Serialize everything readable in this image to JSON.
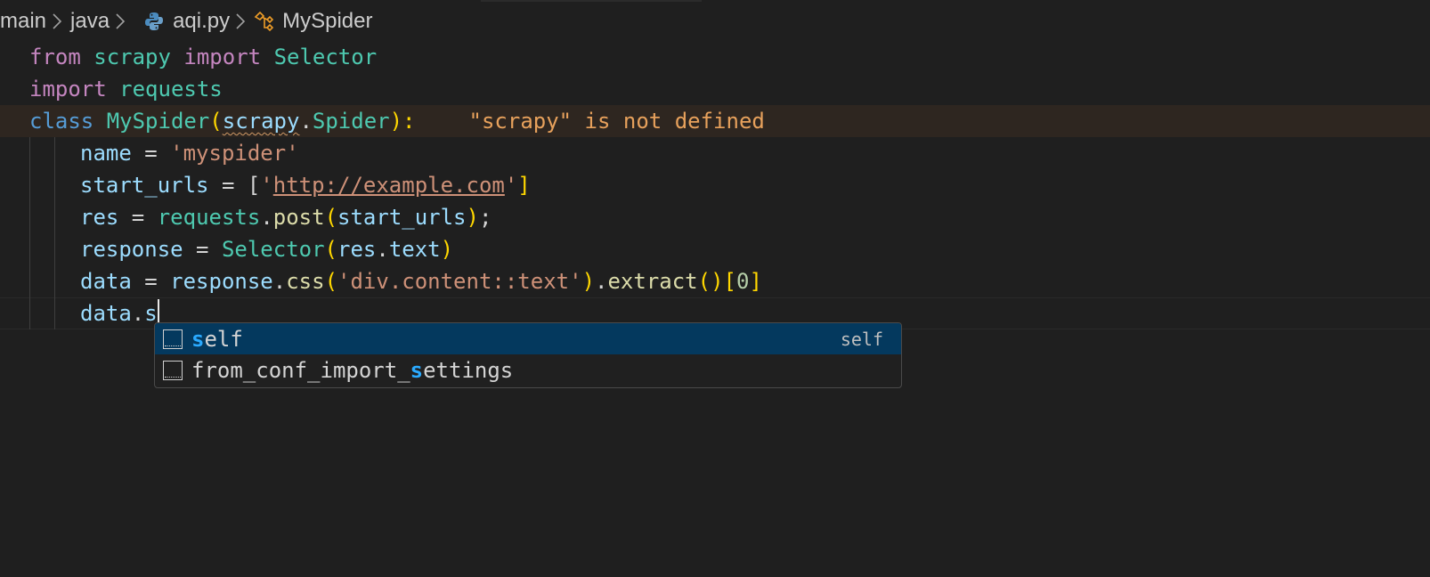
{
  "breadcrumb": {
    "items": [
      {
        "label": "main",
        "icon": null
      },
      {
        "label": "java",
        "icon": null
      },
      {
        "label": "aqi.py",
        "icon": "python-file-icon"
      },
      {
        "label": "MySpider",
        "icon": "symbol-class-icon"
      }
    ]
  },
  "editor": {
    "line1": {
      "t1": "from",
      "t2": " ",
      "t3": "scrapy",
      "t4": " ",
      "t5": "import",
      "t6": " ",
      "t7": "Selector"
    },
    "line2": {
      "t1": "import",
      "t2": " ",
      "t3": "requests"
    },
    "line3": {
      "t1": "class",
      "t2": " ",
      "t3": "MySpider",
      "t4": "(",
      "t5": "scrapy",
      "t6": ".",
      "t7": "Spider",
      "t8": "):",
      "diagnostic": "\"scrapy\" is not defined"
    },
    "line4": {
      "t1": "name",
      "t2": " = ",
      "t3": "'myspider'"
    },
    "line5": {
      "t1": "start_urls",
      "t2": " = [",
      "t3": "'",
      "t4": "http://example.com",
      "t5": "'",
      "t6": "]"
    },
    "line6": {
      "t1": "res",
      "t2": " = ",
      "t3": "requests",
      "t4": ".",
      "t5": "post",
      "t6": "(",
      "t7": "start_urls",
      "t8": ")",
      "t9": ";"
    },
    "line7": {
      "t1": "response",
      "t2": " = ",
      "t3": "Selector",
      "t4": "(",
      "t5": "res",
      "t6": ".",
      "t7": "text",
      "t8": ")"
    },
    "line8": {
      "t1": "data",
      "t2": " = ",
      "t3": "response",
      "t4": ".",
      "t5": "css",
      "t6": "(",
      "t7": "'div.content::text'",
      "t8": ")",
      "t9": ".",
      "t10": "extract",
      "t11": "()",
      "t12": "[",
      "t13": "0",
      "t14": "]"
    },
    "line9": {
      "t1": "data",
      "t2": ".",
      "t3": "s"
    }
  },
  "suggest": {
    "items": [
      {
        "match": "s",
        "rest": "elf",
        "detail": "self",
        "selected": true,
        "icon": "symbol-text-icon"
      },
      {
        "pre": "from_conf_import_",
        "match": "s",
        "rest": "ettings",
        "selected": false,
        "icon": "symbol-text-icon"
      }
    ]
  },
  "colors": {
    "background": "#1f1f1f",
    "keyword": "#c586c0",
    "class": "#4ec9b0",
    "string": "#ce9178",
    "variable": "#9cdcfe",
    "warning": "#e7a15c",
    "suggest_selected": "#04395e",
    "match_highlight": "#2aaaff"
  }
}
